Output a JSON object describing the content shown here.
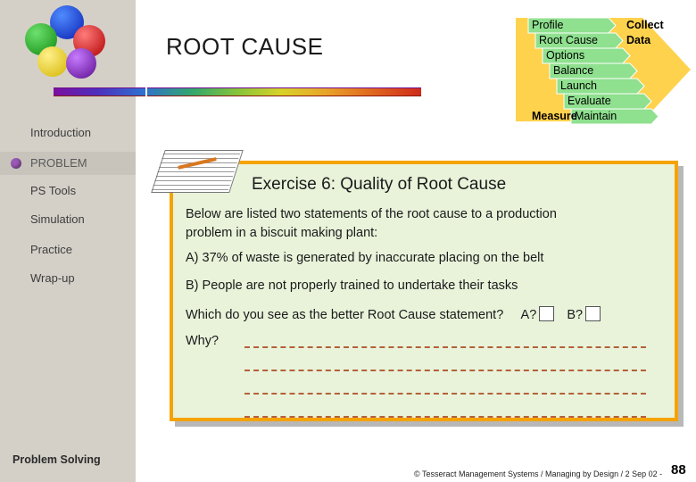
{
  "header": {
    "title": "ROOT CAUSE"
  },
  "sidebar": {
    "items": [
      {
        "label": "Introduction",
        "current": false
      },
      {
        "label": "PROBLEM",
        "current": true
      },
      {
        "label": "PS Tools",
        "current": false
      },
      {
        "label": "Simulation",
        "current": false
      },
      {
        "label": "Practice",
        "current": false
      },
      {
        "label": "Wrap-up",
        "current": false
      }
    ],
    "footer_title": "Problem Solving"
  },
  "chevrons": {
    "items": [
      {
        "label": "Profile",
        "color": "#ffd24d"
      },
      {
        "label": "Root Cause",
        "color": "#ffd24d"
      },
      {
        "label": "Options",
        "color": "#ffd24d"
      },
      {
        "label": "Balance",
        "color": "#ffd24d"
      },
      {
        "label": "Launch",
        "color": "#ffd24d"
      },
      {
        "label": "Evaluate",
        "color": "#ffd24d"
      },
      {
        "label": "Maintain",
        "color": "#ffd24d"
      }
    ],
    "side_labels": {
      "collect": "Collect",
      "data": "Data",
      "measure": "Measure"
    }
  },
  "content": {
    "exercise_title": "Exercise 6: Quality of Root Cause",
    "intro_line1": "Below are listed two statements of the root cause to a production",
    "intro_line2": "problem in a biscuit making plant:",
    "option_a": "A) 37% of waste is generated by inaccurate placing on the belt",
    "option_b": "B) People are not properly trained to undertake their tasks",
    "question": "Which do you see as the better Root Cause statement?",
    "choice_a_label": "A?",
    "choice_b_label": "B?",
    "why": "Why?"
  },
  "footer": {
    "copyright": "© Tesseract Management Systems / Managing by Design / 2 Sep 02 -",
    "page_number": "88"
  },
  "colors": {
    "panel_border": "#f5a300",
    "panel_background": "#e8f3da",
    "sidebar_background": "#d4d0c8",
    "chevron_yellow": "#ffd24d",
    "accent_blue": "#0000cc"
  }
}
